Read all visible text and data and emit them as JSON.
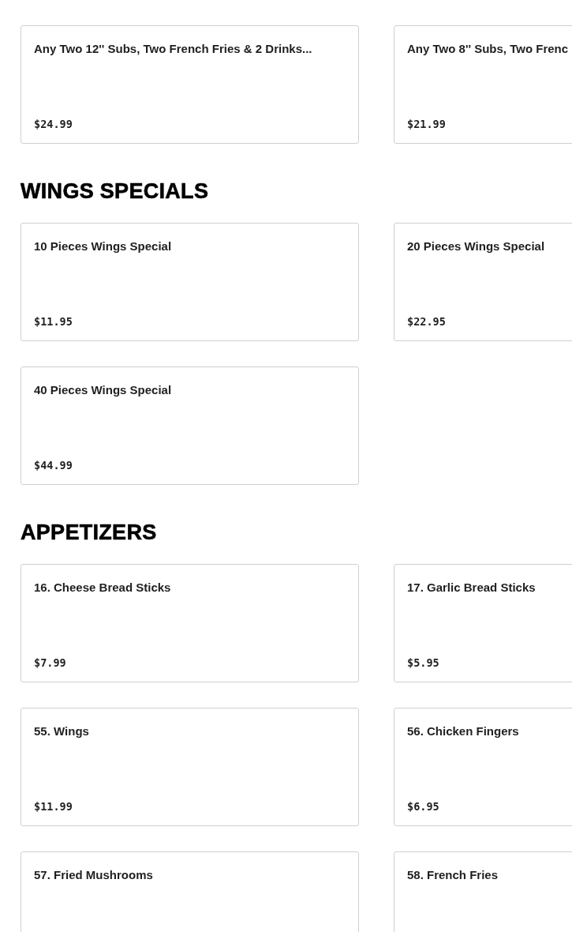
{
  "sections": [
    {
      "items": [
        {
          "name": "Any Two 12'' Subs, Two French Fries & 2 Drinks...",
          "price": "$24.99"
        },
        {
          "name": "Any Two 8'' Subs, Two Frenc",
          "price": "$21.99"
        }
      ]
    },
    {
      "title": "WINGS SPECIALS",
      "items": [
        {
          "name": "10 Pieces Wings Special",
          "price": "$11.95"
        },
        {
          "name": "20 Pieces Wings Special",
          "price": "$22.95"
        },
        {
          "name": "40 Pieces Wings Special",
          "price": "$44.99"
        }
      ]
    },
    {
      "title": "APPETIZERS",
      "items": [
        {
          "name": "16. Cheese Bread Sticks",
          "price": "$7.99"
        },
        {
          "name": "17. Garlic Bread Sticks",
          "price": "$5.95"
        },
        {
          "name": "55. Wings",
          "price": "$11.99"
        },
        {
          "name": "56. Chicken Fingers",
          "price": "$6.95"
        },
        {
          "name": "57. Fried Mushrooms"
        },
        {
          "name": "58. French Fries"
        }
      ]
    }
  ]
}
